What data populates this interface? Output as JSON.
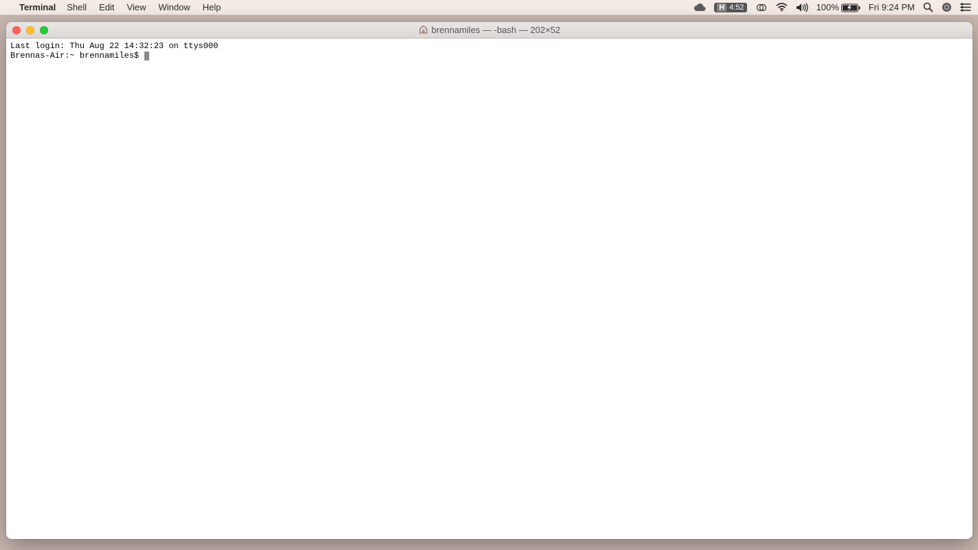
{
  "menubar": {
    "app_name": "Terminal",
    "items": [
      "Shell",
      "Edit",
      "View",
      "Window",
      "Help"
    ]
  },
  "statusbar": {
    "h_badge_time": "4:52",
    "battery_text": "100%",
    "clock": "Fri 9:24 PM"
  },
  "window": {
    "title": "brennamiles — -bash — 202×52"
  },
  "terminal": {
    "last_login": "Last login: Thu Aug 22 14:32:23 on ttys000",
    "prompt": "Brennas-Air:~ brennamiles$ "
  }
}
